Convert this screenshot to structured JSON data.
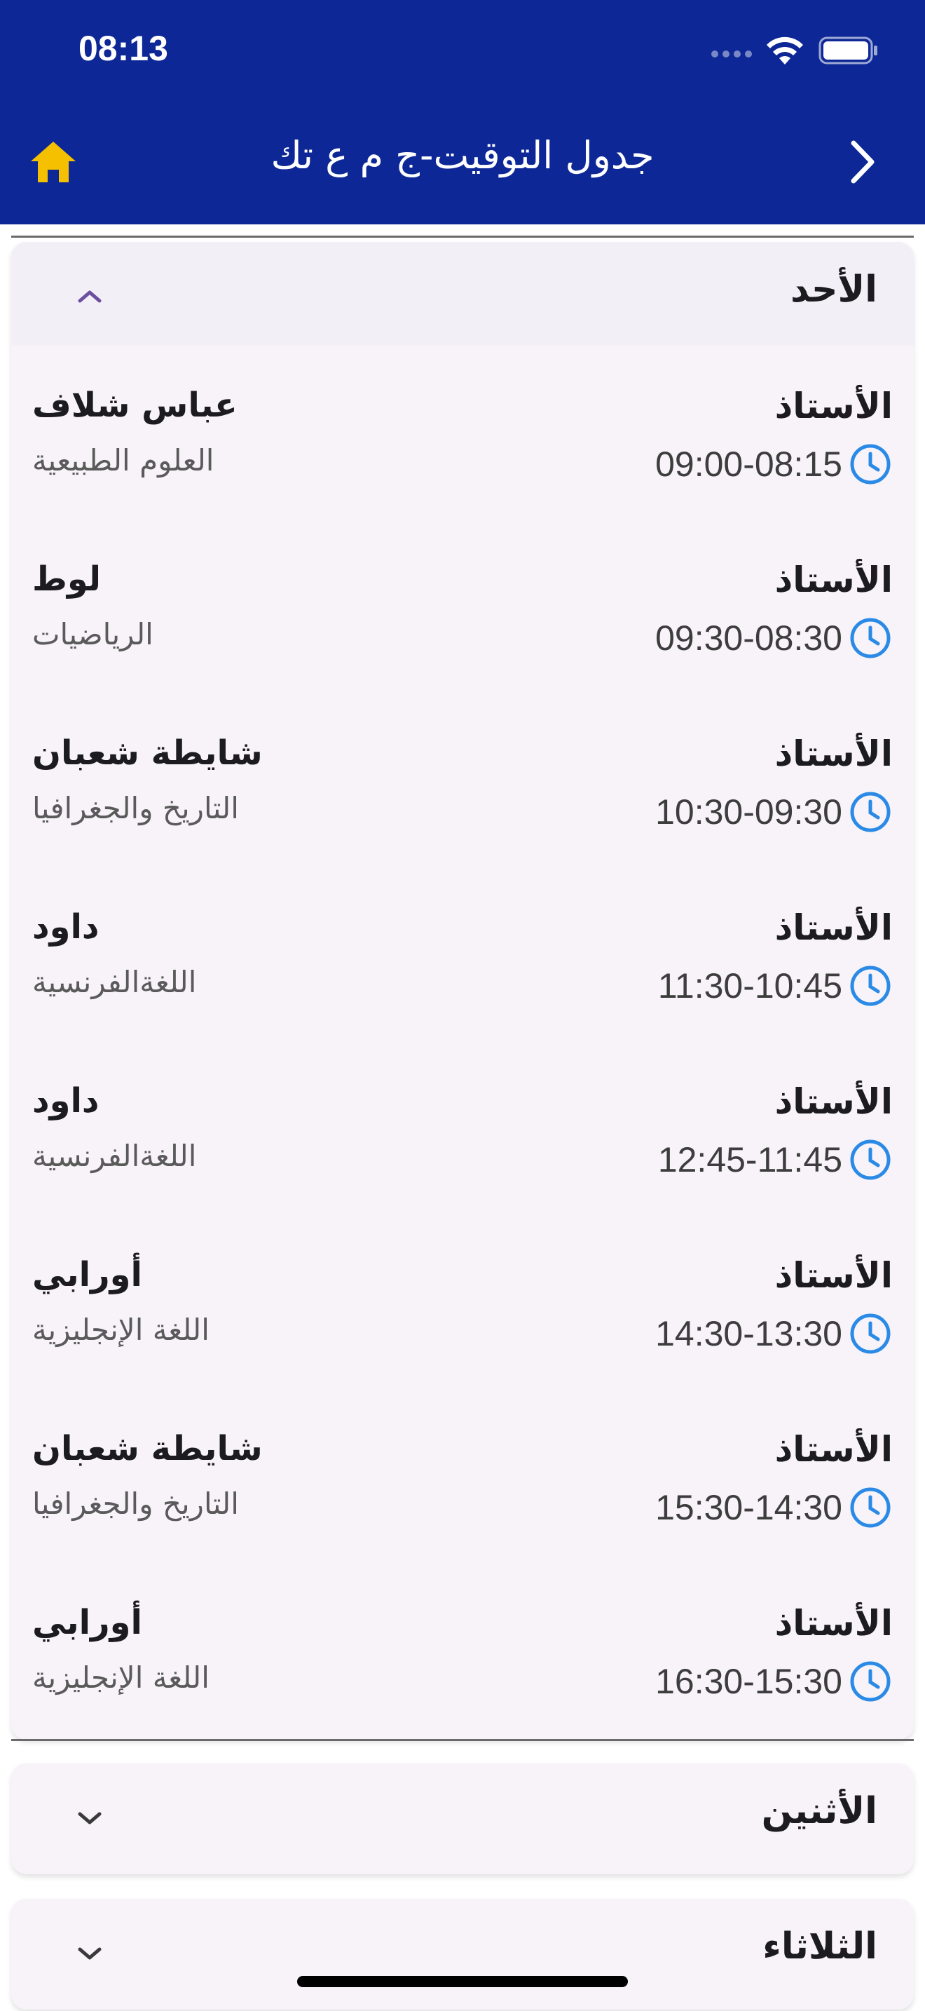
{
  "status_bar": {
    "time": "08:13"
  },
  "header": {
    "title": "جدول التوقيت-ج م ع تك",
    "home_icon": "home-icon",
    "back_icon": "chevron-right-icon",
    "background_color": "#0d2896",
    "home_icon_color": "#f5c000"
  },
  "days": [
    {
      "name": "الأحد",
      "expanded": true,
      "entries": [
        {
          "label": "الأستاذ",
          "teacher": "عباس شلاف",
          "time": "09:00-08:15",
          "subject": "العلوم الطبيعية"
        },
        {
          "label": "الأستاذ",
          "teacher": "لوط",
          "time": "09:30-08:30",
          "subject": "الرياضيات"
        },
        {
          "label": "الأستاذ",
          "teacher": "شايطة شعبان",
          "time": "10:30-09:30",
          "subject": "التاريخ والجغرافيا"
        },
        {
          "label": "الأستاذ",
          "teacher": "داود",
          "time": "11:30-10:45",
          "subject": "اللغةالفرنسية"
        },
        {
          "label": "الأستاذ",
          "teacher": "داود",
          "time": "12:45-11:45",
          "subject": "اللغةالفرنسية"
        },
        {
          "label": "الأستاذ",
          "teacher": "أورابي",
          "time": "14:30-13:30",
          "subject": "اللغة الإنجليزية"
        },
        {
          "label": "الأستاذ",
          "teacher": "شايطة شعبان",
          "time": "15:30-14:30",
          "subject": "التاريخ والجغرافيا"
        },
        {
          "label": "الأستاذ",
          "teacher": "أورابي",
          "time": "16:30-15:30",
          "subject": "اللغة الإنجليزية"
        }
      ]
    },
    {
      "name": "الأثنين",
      "expanded": false
    },
    {
      "name": "الثلاثاء",
      "expanded": false
    }
  ],
  "colors": {
    "clock_icon": "#2a8ae6",
    "card_background": "#f7f3f9",
    "chevron_open": "#6b4fa0",
    "chevron_closed": "#3a3a3a"
  }
}
